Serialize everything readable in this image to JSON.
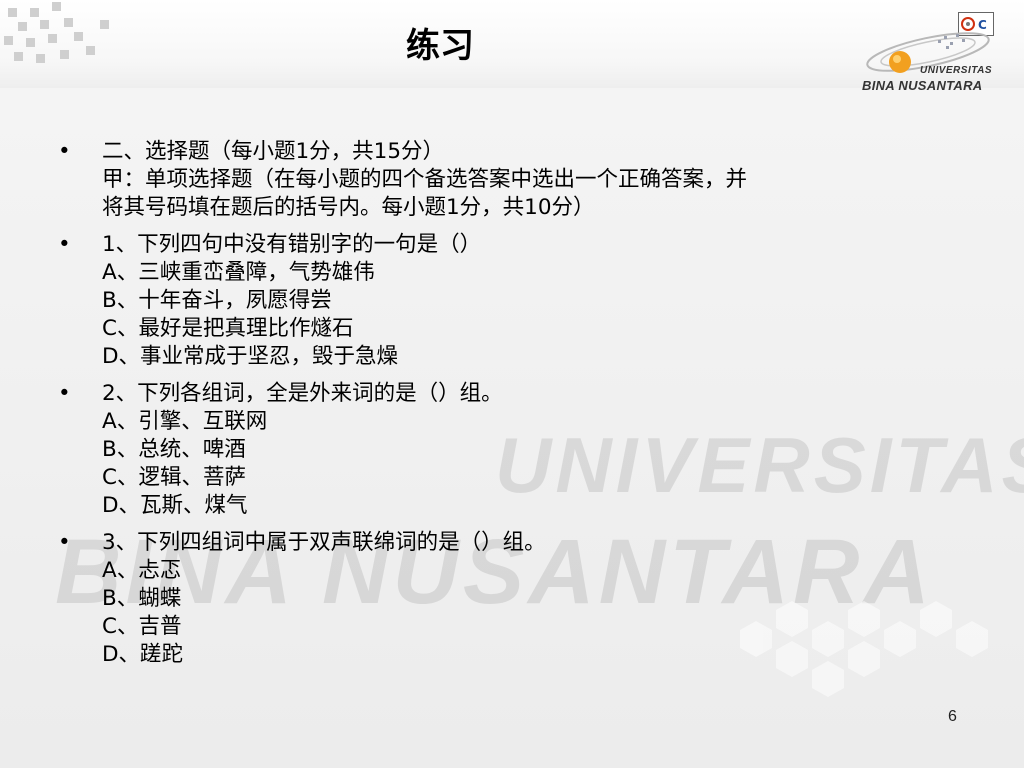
{
  "slide": {
    "title": "练习",
    "page_number": "6",
    "logo": {
      "line1": "UNIVERSITAS",
      "line2": "BINA NUSANTARA"
    },
    "watermark": {
      "line1": "UNIVERSITAS",
      "line2": "BINA NUSANTARA"
    },
    "bullet_symbol": "•",
    "items": [
      {
        "lines": [
          "二、选择题（每小题1分，共15分）",
          "甲：单项选择题（在每小题的四个备选答案中选出一个正确答案，并",
          "将其号码填在题后的括号内。每小题1分，共10分）"
        ]
      },
      {
        "lines": [
          "1、下列四句中没有错别字的一句是（）",
          "A、三峡重峦叠障，气势雄伟",
          "B、十年奋斗，夙愿得尝",
          "C、最好是把真理比作燧石",
          "D、事业常成于坚忍，毁于急燥"
        ]
      },
      {
        "lines": [
          "2、下列各组词，全是外来词的是（）组。",
          "A、引擎、互联网",
          "B、总统、啤酒",
          "C、逻辑、菩萨",
          "D、瓦斯、煤气"
        ]
      },
      {
        "lines": [
          "3、下列四组词中属于双声联绵词的是（）组。",
          "A、忐忑",
          "B、蝴蝶",
          "C、吉普",
          "D、蹉跎"
        ]
      }
    ]
  }
}
